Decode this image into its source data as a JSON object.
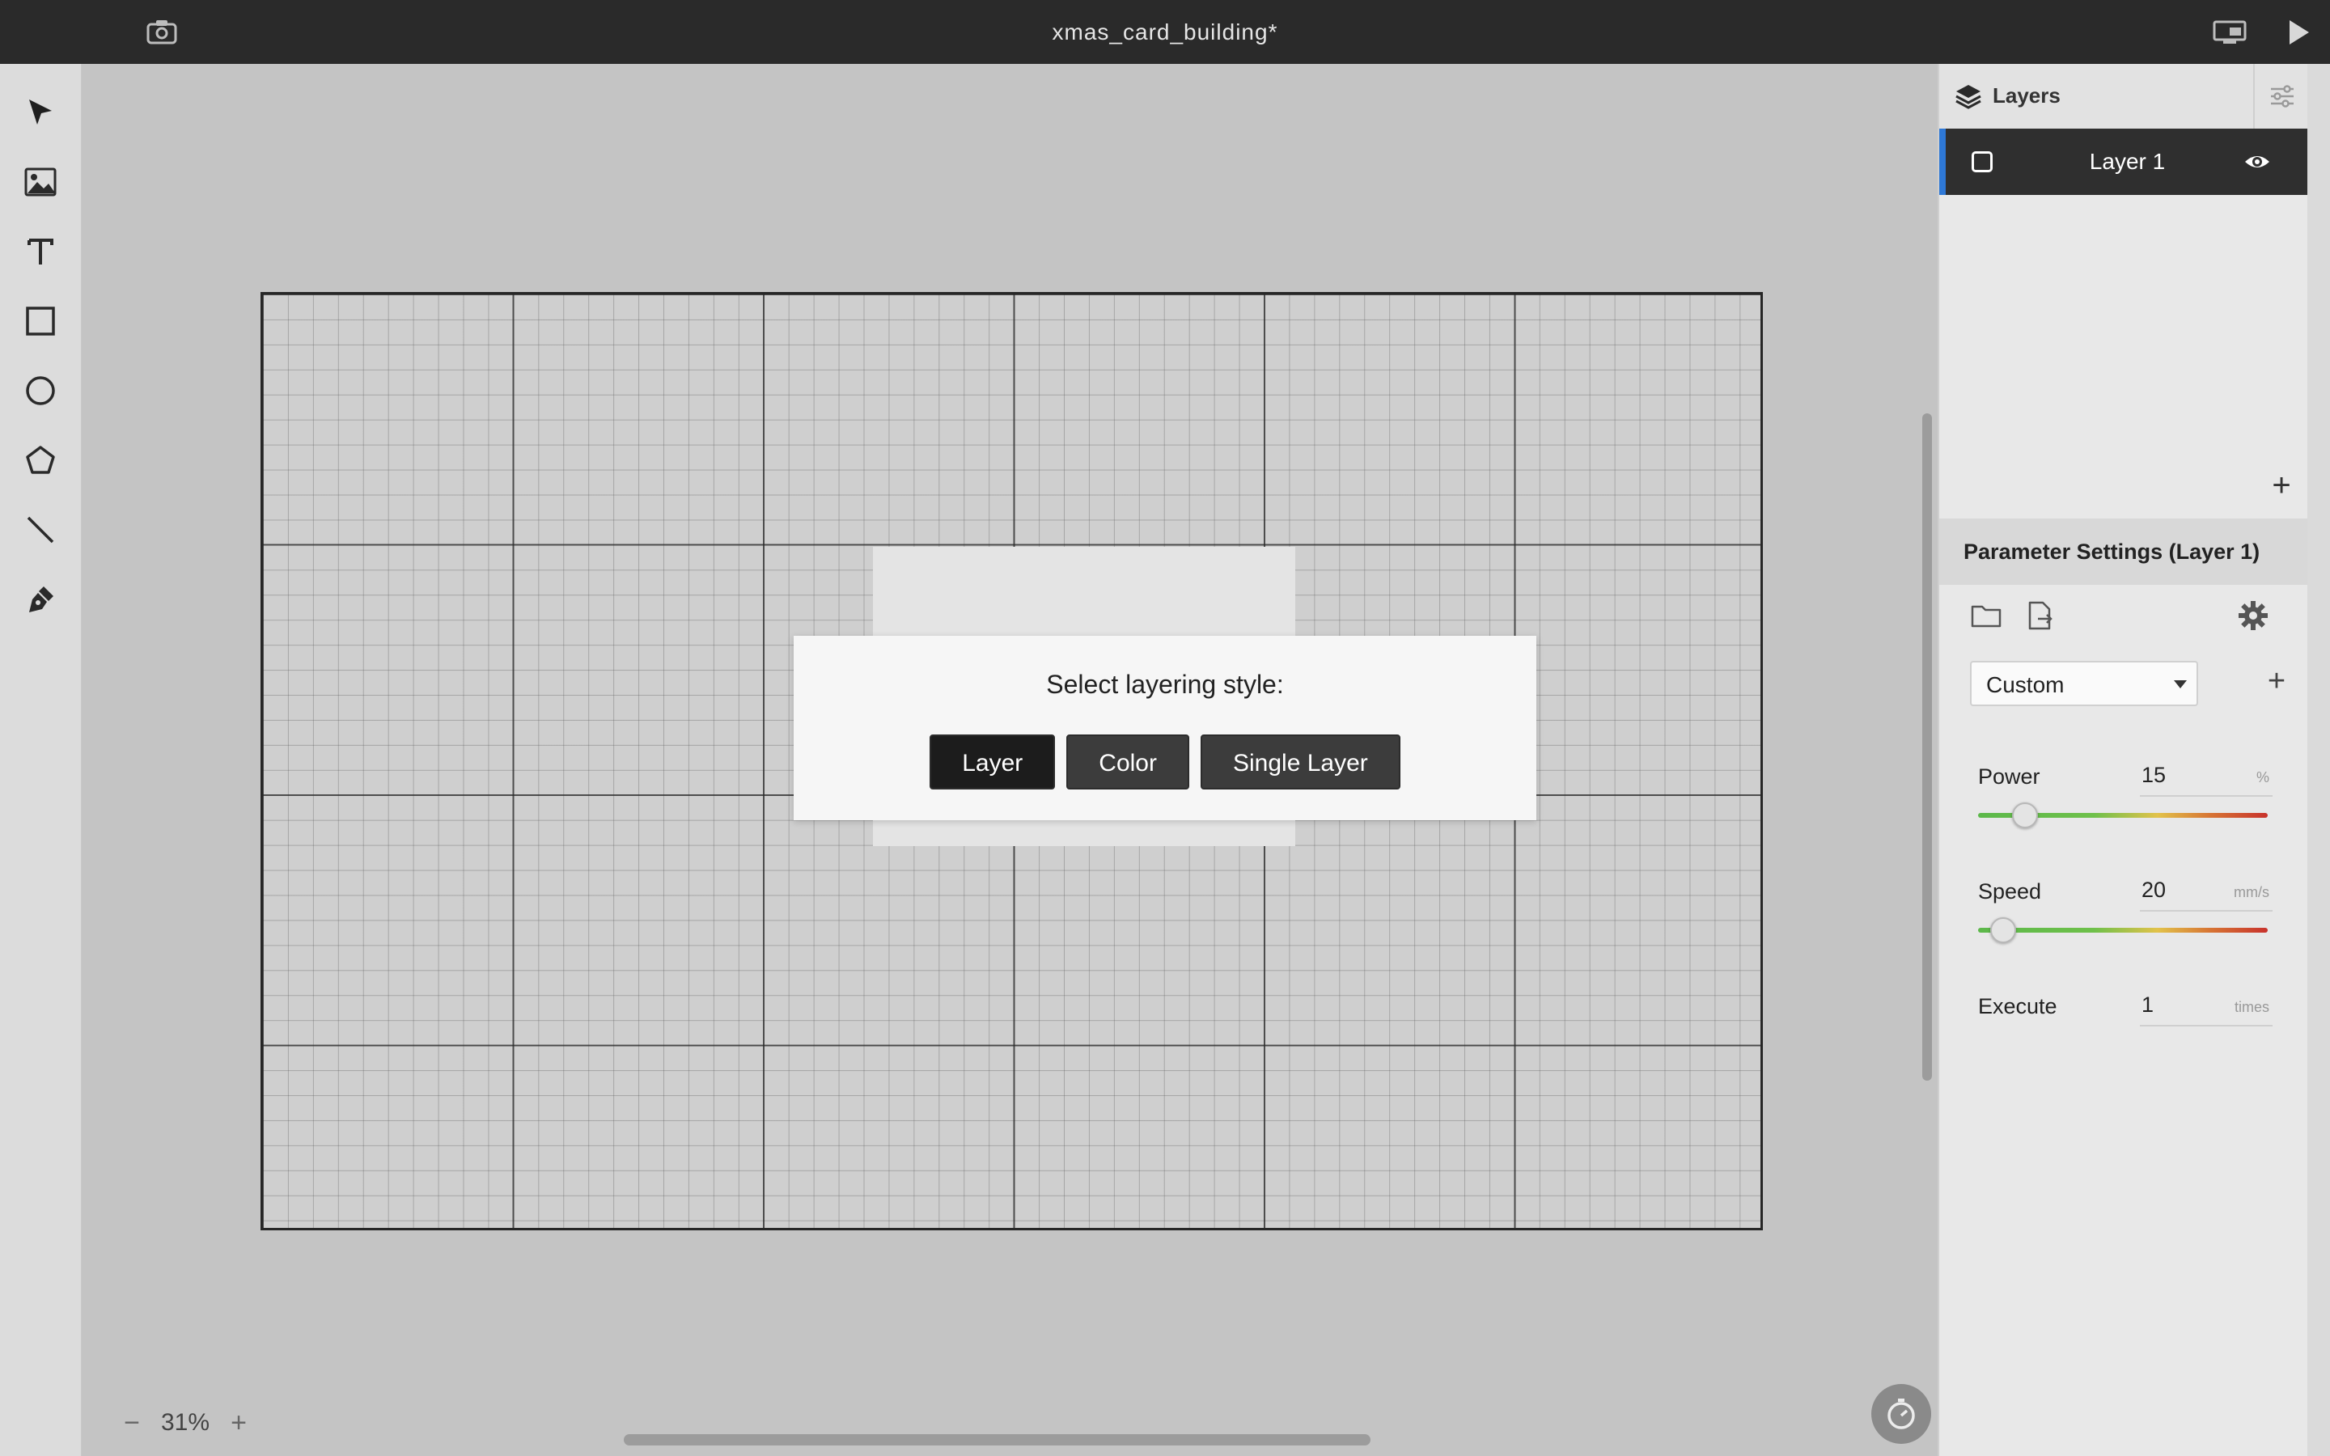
{
  "window": {
    "title": "xmas_card_building*"
  },
  "toolbar": {
    "tools": [
      "select-tool",
      "image-tool",
      "text-tool",
      "rectangle-tool",
      "ellipse-tool",
      "polygon-tool",
      "line-tool",
      "pen-tool"
    ]
  },
  "canvas": {
    "zoom": {
      "minus": "−",
      "value": "31%",
      "plus": "+"
    }
  },
  "dialog": {
    "title": "Select layering style:",
    "buttons": {
      "layer": "Layer",
      "color": "Color",
      "single_layer": "Single Layer"
    }
  },
  "layers_panel": {
    "title": "Layers",
    "layers": [
      {
        "name": "Layer 1",
        "visible": true,
        "selected": true
      }
    ],
    "add_label": "+"
  },
  "parameters": {
    "title": "Parameter Settings (Layer 1)",
    "preset": "Custom",
    "add_preset": "+",
    "power": {
      "label": "Power",
      "value": "15",
      "unit": "%",
      "level": 0.15
    },
    "speed": {
      "label": "Speed",
      "value": "20",
      "unit": "mm/s",
      "level": 0.06
    },
    "execute": {
      "label": "Execute",
      "value": "1",
      "unit": "times"
    }
  },
  "colors": {
    "accent": "#2e78d6",
    "titlebar": "#2a2a2a",
    "selected_row": "#2f2f2f"
  }
}
